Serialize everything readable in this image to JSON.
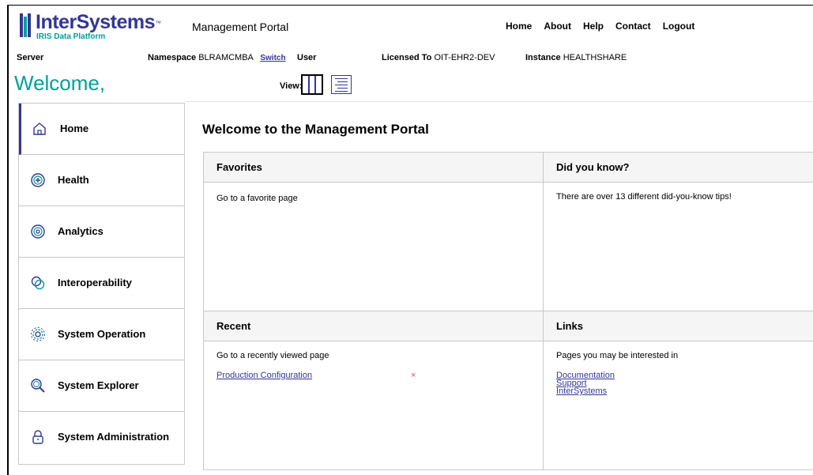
{
  "header": {
    "logo_text": "InterSystems",
    "logo_tm": "™",
    "logo_sub": "IRIS Data Platform",
    "app_title": "Management Portal",
    "nav": [
      "Home",
      "About",
      "Help",
      "Contact",
      "Logout"
    ]
  },
  "info": {
    "server_label": "Server",
    "namespace_label": "Namespace",
    "namespace_value": "BLRAMCMBA",
    "switch_label": "Switch",
    "user_label": "User",
    "licensed_label": "Licensed To",
    "licensed_value": "OIT-EHR2-DEV",
    "instance_label": "Instance",
    "instance_value": "HEALTHSHARE"
  },
  "welcome": "Welcome,",
  "view_label": "View:",
  "sidebar": {
    "items": [
      {
        "label": "Home",
        "icon": "home-icon"
      },
      {
        "label": "Health",
        "icon": "health-plus-icon"
      },
      {
        "label": "Analytics",
        "icon": "analytics-target-icon"
      },
      {
        "label": "Interoperability",
        "icon": "interoperability-rings-icon"
      },
      {
        "label": "System Operation",
        "icon": "gear-icon"
      },
      {
        "label": "System Explorer",
        "icon": "magnifier-icon"
      },
      {
        "label": "System Administration",
        "icon": "lock-icon"
      }
    ]
  },
  "main": {
    "title": "Welcome to the Management Portal",
    "favorites": {
      "title": "Favorites",
      "text": "Go to a favorite page"
    },
    "didyouknow": {
      "title": "Did you know?",
      "text": "There are over 13 different did-you-know tips!"
    },
    "recent": {
      "title": "Recent",
      "text": "Go to a recently viewed page",
      "items": [
        "Production Configuration"
      ],
      "remove_glyph": "×"
    },
    "links": {
      "title": "Links",
      "text": "Pages you may be interested in",
      "items": [
        "Documentation",
        "Support",
        "InterSystems"
      ]
    }
  },
  "colors": {
    "brand": "#333694",
    "accent": "#00a09a",
    "remove": "#e05050"
  }
}
